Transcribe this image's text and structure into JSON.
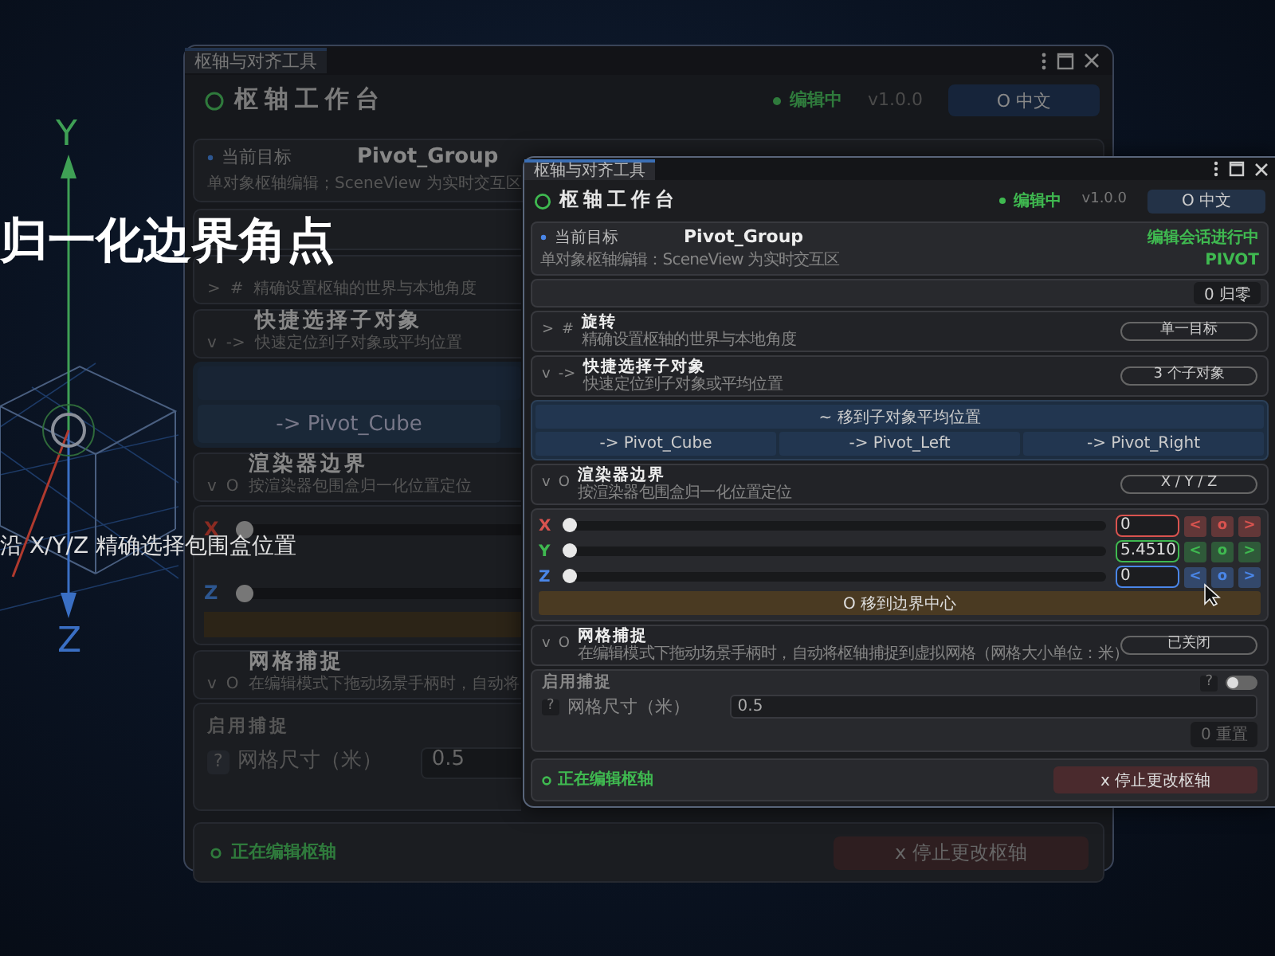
{
  "scene": {
    "axis_labels": [
      "Y",
      "Z"
    ]
  },
  "headline": "归一化边界角点",
  "subtitle": "沿 X/Y/Z 精确选择包围盒位置",
  "back_window": {
    "tab": "枢轴与对齐工具",
    "title": "枢轴工作台",
    "status": "编辑中",
    "version": "v1.0.0",
    "language_button": "O 中文",
    "target": {
      "label": "当前目标",
      "name": "Pivot_Group",
      "hint": "单对象枢轴编辑；SceneView 为实时交互区"
    },
    "rows": [
      {
        "kind": "scrolled"
      },
      {
        "kind": "section",
        "caret": ">",
        "symbol": "#",
        "description": "精确设置枢轴的世界与本地角度"
      },
      {
        "kind": "section",
        "caret": "v",
        "symbol": "->",
        "title": "快捷选择子对象",
        "description": "快速定位到子对象或平均位置"
      },
      {
        "kind": "children",
        "buttons": [
          "-> Pivot_Cube"
        ]
      },
      {
        "kind": "section",
        "caret": "v",
        "symbol": "O",
        "title": "渲染器边界",
        "description": "按渲染器包围盒归一化位置定位"
      },
      {
        "kind": "axes",
        "sliders": [
          {
            "label": "X",
            "color": "#8a2b22",
            "level": 0
          },
          {
            "label": "Z",
            "color": "#2d568f",
            "level": 0
          }
        ]
      },
      {
        "kind": "section",
        "caret": "v",
        "symbol": "O",
        "title": "网格捕捉",
        "description": "在编辑模式下拖动场景手柄时，自动将"
      },
      {
        "kind": "snap",
        "enable_label": "启用捕捉",
        "size_help": "?",
        "size_label": "网格尺寸（米）",
        "size_value": "0.5"
      }
    ],
    "footer": {
      "status": "正在编辑枢轴",
      "stop_button": "x 停止更改枢轴"
    }
  },
  "front_window": {
    "tab": "枢轴与对齐工具",
    "title": "枢轴工作台",
    "status": "编辑中",
    "version": "v1.0.0",
    "language_button": "O 中文",
    "target": {
      "label": "当前目标",
      "name": "Pivot_Group",
      "status": "编辑会话进行中",
      "hint": "单对象枢轴编辑：SceneView 为实时交互区",
      "badge": "PIVOT"
    },
    "rows": [
      {
        "kind": "scrolled",
        "button": "0 归零"
      },
      {
        "kind": "section",
        "caret": ">",
        "symbol": "#",
        "title": "旋转",
        "description": "精确设置枢轴的世界与本地角度",
        "pill": "单一目标"
      },
      {
        "kind": "section",
        "caret": "v",
        "symbol": "->",
        "title": "快捷选择子对象",
        "description": "快速定位到子对象或平均位置",
        "pill": "3 个子对象"
      },
      {
        "kind": "children",
        "main_button": "~ 移到子对象平均位置",
        "buttons": [
          "-> Pivot_Cube",
          "-> Pivot_Left",
          "-> Pivot_Right"
        ]
      },
      {
        "kind": "section",
        "caret": "v",
        "symbol": "O",
        "title": "渲染器边界",
        "description": "按渲染器包围盒归一化位置定位",
        "pill": "X / Y / Z"
      },
      {
        "kind": "axes",
        "sliders": [
          {
            "label": "X",
            "color": "#d9534f",
            "level": 0,
            "value": "0",
            "buttons": [
              "<",
              "o",
              ">"
            ]
          },
          {
            "label": "Y",
            "color": "#3fb950",
            "level": 0,
            "value": "5.4510",
            "buttons": [
              "<",
              "o",
              ">"
            ]
          },
          {
            "label": "Z",
            "color": "#4a86e8",
            "level": 0,
            "value": "0",
            "buttons": [
              "<",
              "o",
              ">"
            ]
          }
        ],
        "action_button": "O 移到边界中心"
      },
      {
        "kind": "section",
        "caret": "v",
        "symbol": "O",
        "title": "网格捕捉",
        "description": "在编辑模式下拖动场景手柄时，自动将枢轴捕捉到虚拟网格（网格大小单位：米）",
        "pill": "已关闭"
      },
      {
        "kind": "snap",
        "enable_label": "启用捕捉",
        "help": "?",
        "on": false,
        "size_help": "?",
        "size_label": "网格尺寸（米）",
        "size_value": "0.5",
        "reset_button": "0 重置"
      }
    ],
    "footer": {
      "status": "正在编辑枢轴",
      "stop_button": "x 停止更改枢轴"
    }
  }
}
